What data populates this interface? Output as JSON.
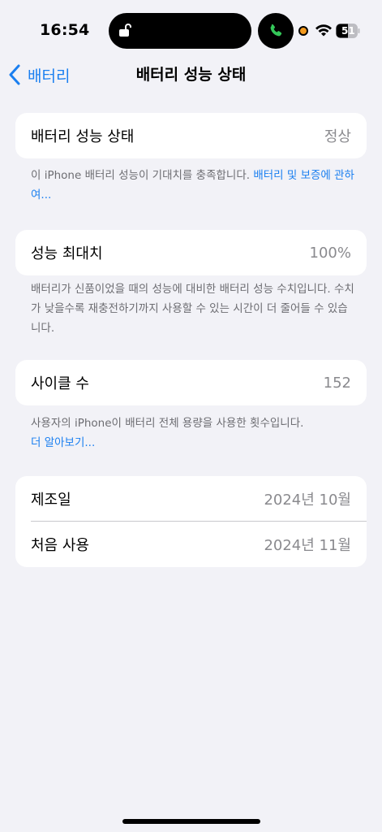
{
  "status_bar": {
    "time": "16:54",
    "battery_level": "51",
    "accent_call": "#34c759",
    "accent_indicator": "#f39a1e"
  },
  "nav": {
    "back_label": "배터리",
    "title": "배터리 성능 상태"
  },
  "health": {
    "label": "배터리 성능 상태",
    "value": "정상",
    "footnote_text": "이 iPhone 배터리 성능이 기대치를 충족합니다. ",
    "footnote_link": "배터리 및 보증에 관하여..."
  },
  "max_capacity": {
    "label": "성능 최대치",
    "value": "100%",
    "footnote": "배터리가 신품이었을 때의 성능에 대비한 배터리 성능 수치입니다. 수치가 낮을수록 재충전하기까지 사용할 수 있는 시간이 더 줄어들 수 있습니다."
  },
  "cycle_count": {
    "label": "사이클 수",
    "value": "152",
    "footnote_text": "사용자의 iPhone이 배터리 전체 용량을 사용한 횟수입니다.",
    "footnote_link": "더 알아보기..."
  },
  "dates": {
    "manufacture_label": "제조일",
    "manufacture_value": "2024년 10월",
    "first_use_label": "처음 사용",
    "first_use_value": "2024년 11월"
  },
  "colors": {
    "link": "#1a7ff0",
    "background": "#f2f2f7",
    "secondary_text": "#8a8a8e"
  }
}
